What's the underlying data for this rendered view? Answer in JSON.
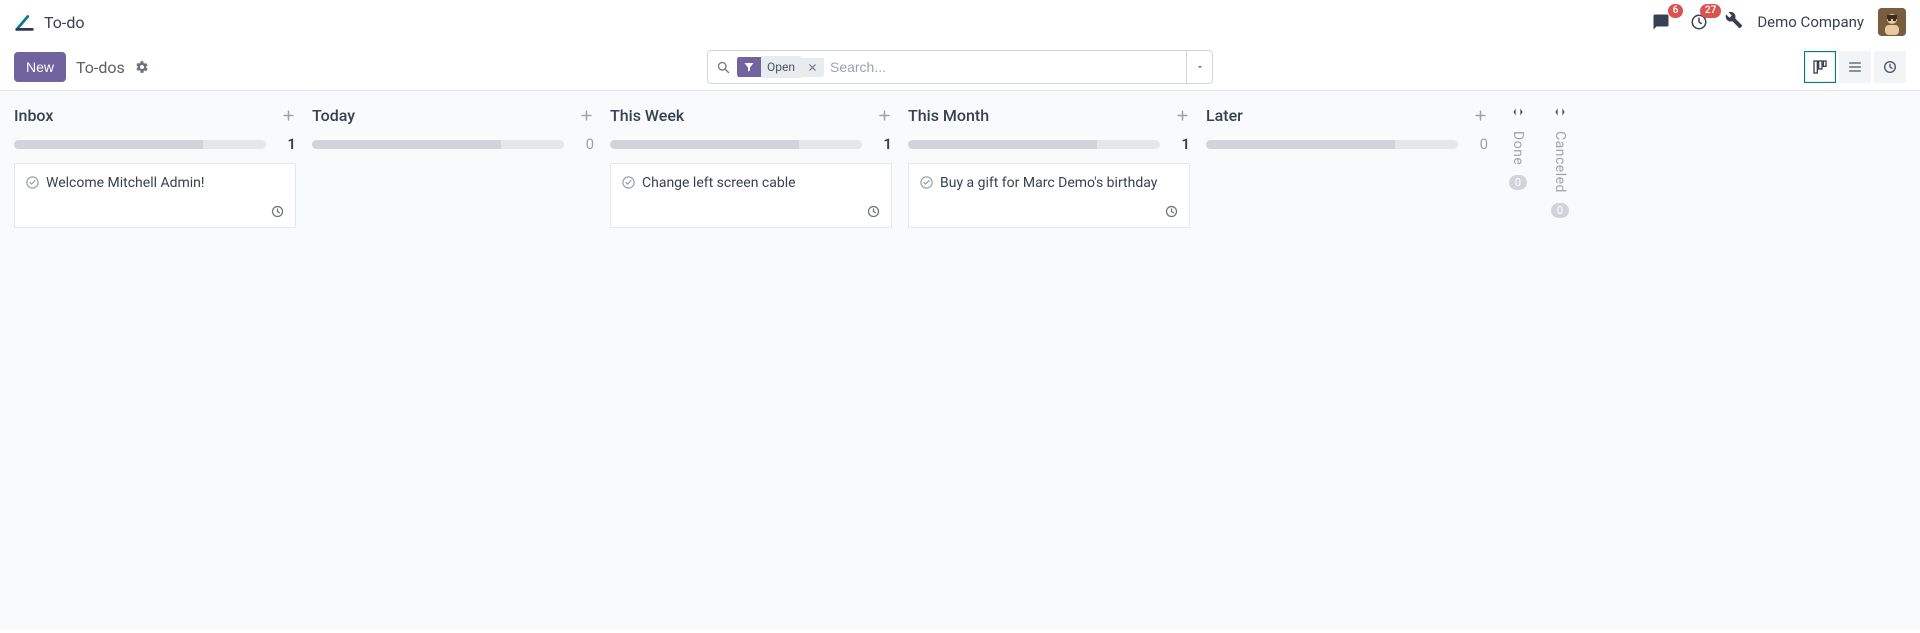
{
  "header": {
    "app_title": "To-do",
    "messages_badge": "6",
    "activities_badge": "27",
    "company_name": "Demo Company"
  },
  "actionbar": {
    "new_label": "New",
    "breadcrumb": "To-dos"
  },
  "search": {
    "filter_label": "Open",
    "placeholder": "Search..."
  },
  "columns": [
    {
      "title": "Inbox",
      "count": "1",
      "progress_pct": 75,
      "cards": [
        {
          "title": "Welcome Mitchell Admin!"
        }
      ]
    },
    {
      "title": "Today",
      "count": "0",
      "progress_pct": 75,
      "cards": []
    },
    {
      "title": "This Week",
      "count": "1",
      "progress_pct": 75,
      "cards": [
        {
          "title": "Change left screen cable"
        }
      ]
    },
    {
      "title": "This Month",
      "count": "1",
      "progress_pct": 75,
      "cards": [
        {
          "title": "Buy a gift for Marc Demo's birthday"
        }
      ]
    },
    {
      "title": "Later",
      "count": "0",
      "progress_pct": 75,
      "cards": []
    }
  ],
  "folded": [
    {
      "title": "Done",
      "count": "0"
    },
    {
      "title": "Canceled",
      "count": "0"
    }
  ]
}
